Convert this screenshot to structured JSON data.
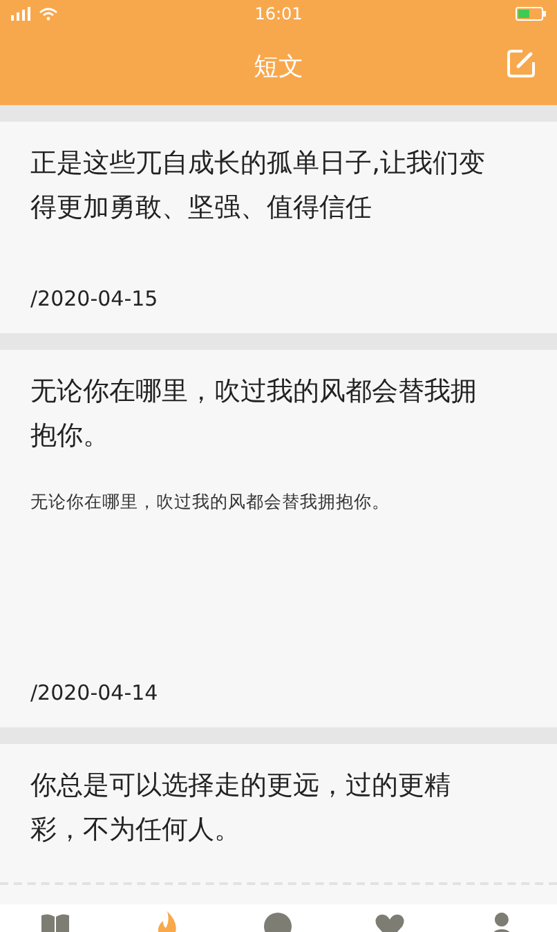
{
  "status_bar": {
    "time": "16:01"
  },
  "header": {
    "title": "短文"
  },
  "posts": [
    {
      "title": "正是这些兀自成长的孤单日子,让我们变得更加勇敢、坚强、值得信任",
      "date": "/2020-04-15"
    },
    {
      "title": "无论你在哪里，吹过我的风都会替我拥抱你。",
      "body": "无论你在哪里，吹过我的风都会替我拥抱你。",
      "date": "/2020-04-14"
    },
    {
      "title": "你总是可以选择走的更远，过的更精彩，不为任何人。"
    }
  ],
  "nav": [
    {
      "kind": "book",
      "selected": false
    },
    {
      "kind": "flame",
      "selected": true
    },
    {
      "kind": "circle",
      "selected": false
    },
    {
      "kind": "heart",
      "selected": false
    },
    {
      "kind": "person",
      "selected": false
    }
  ]
}
